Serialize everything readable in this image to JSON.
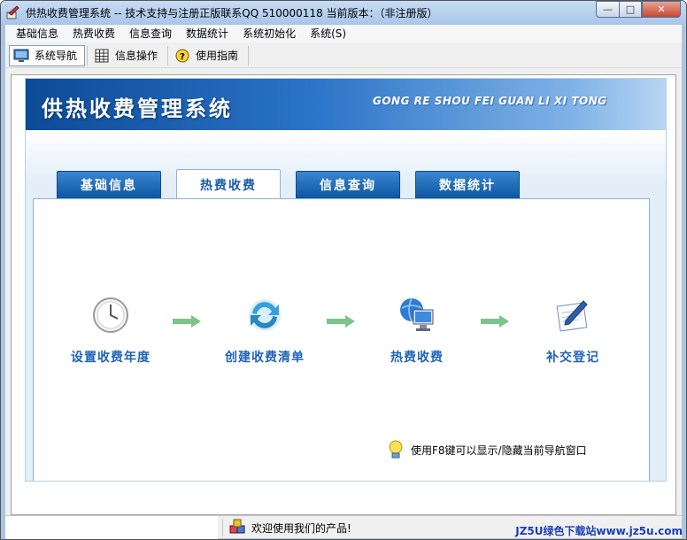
{
  "window": {
    "title": "供热收费管理系统 -- 技术支持与注册正版联系QQ 510000118   当前版本：（非注册版）",
    "minimize_label": "—",
    "maximize_label": "□",
    "close_label": "✕"
  },
  "menu": [
    "基础信息",
    "热费收费",
    "信息查询",
    "数据统计",
    "系统初始化",
    "系统(S)"
  ],
  "toolbar": {
    "nav_label": "系统导航",
    "info_label": "信息操作",
    "guide_label": "使用指南"
  },
  "banner": {
    "title_cn": "供热收费管理系统",
    "title_en": "GONG RE SHOU FEI GUAN LI XI TONG"
  },
  "tabs": [
    {
      "label": "基础信息",
      "active": false
    },
    {
      "label": "热费收费",
      "active": true
    },
    {
      "label": "信息查询",
      "active": false
    },
    {
      "label": "数据统计",
      "active": false
    }
  ],
  "steps": [
    {
      "label": "设置收费年度",
      "icon": "clock-icon"
    },
    {
      "label": "创建收费清单",
      "icon": "refresh-icon"
    },
    {
      "label": "热费收费",
      "icon": "globe-computer-icon"
    },
    {
      "label": "补交登记",
      "icon": "notepad-pencil-icon"
    }
  ],
  "hint": {
    "text": "使用F8键可以显示/隐藏当前导航窗口",
    "icon": "lightbulb-icon"
  },
  "status": {
    "message": "欢迎使用我们的产品!",
    "watermark": "JZ5U绿色下载站www.jz5u.com"
  },
  "colors": {
    "banner_dark": "#0d4a96",
    "tab_blue": "#1a66b8",
    "step_text": "#1f63b5",
    "arrow_green": "#7cc48a"
  }
}
